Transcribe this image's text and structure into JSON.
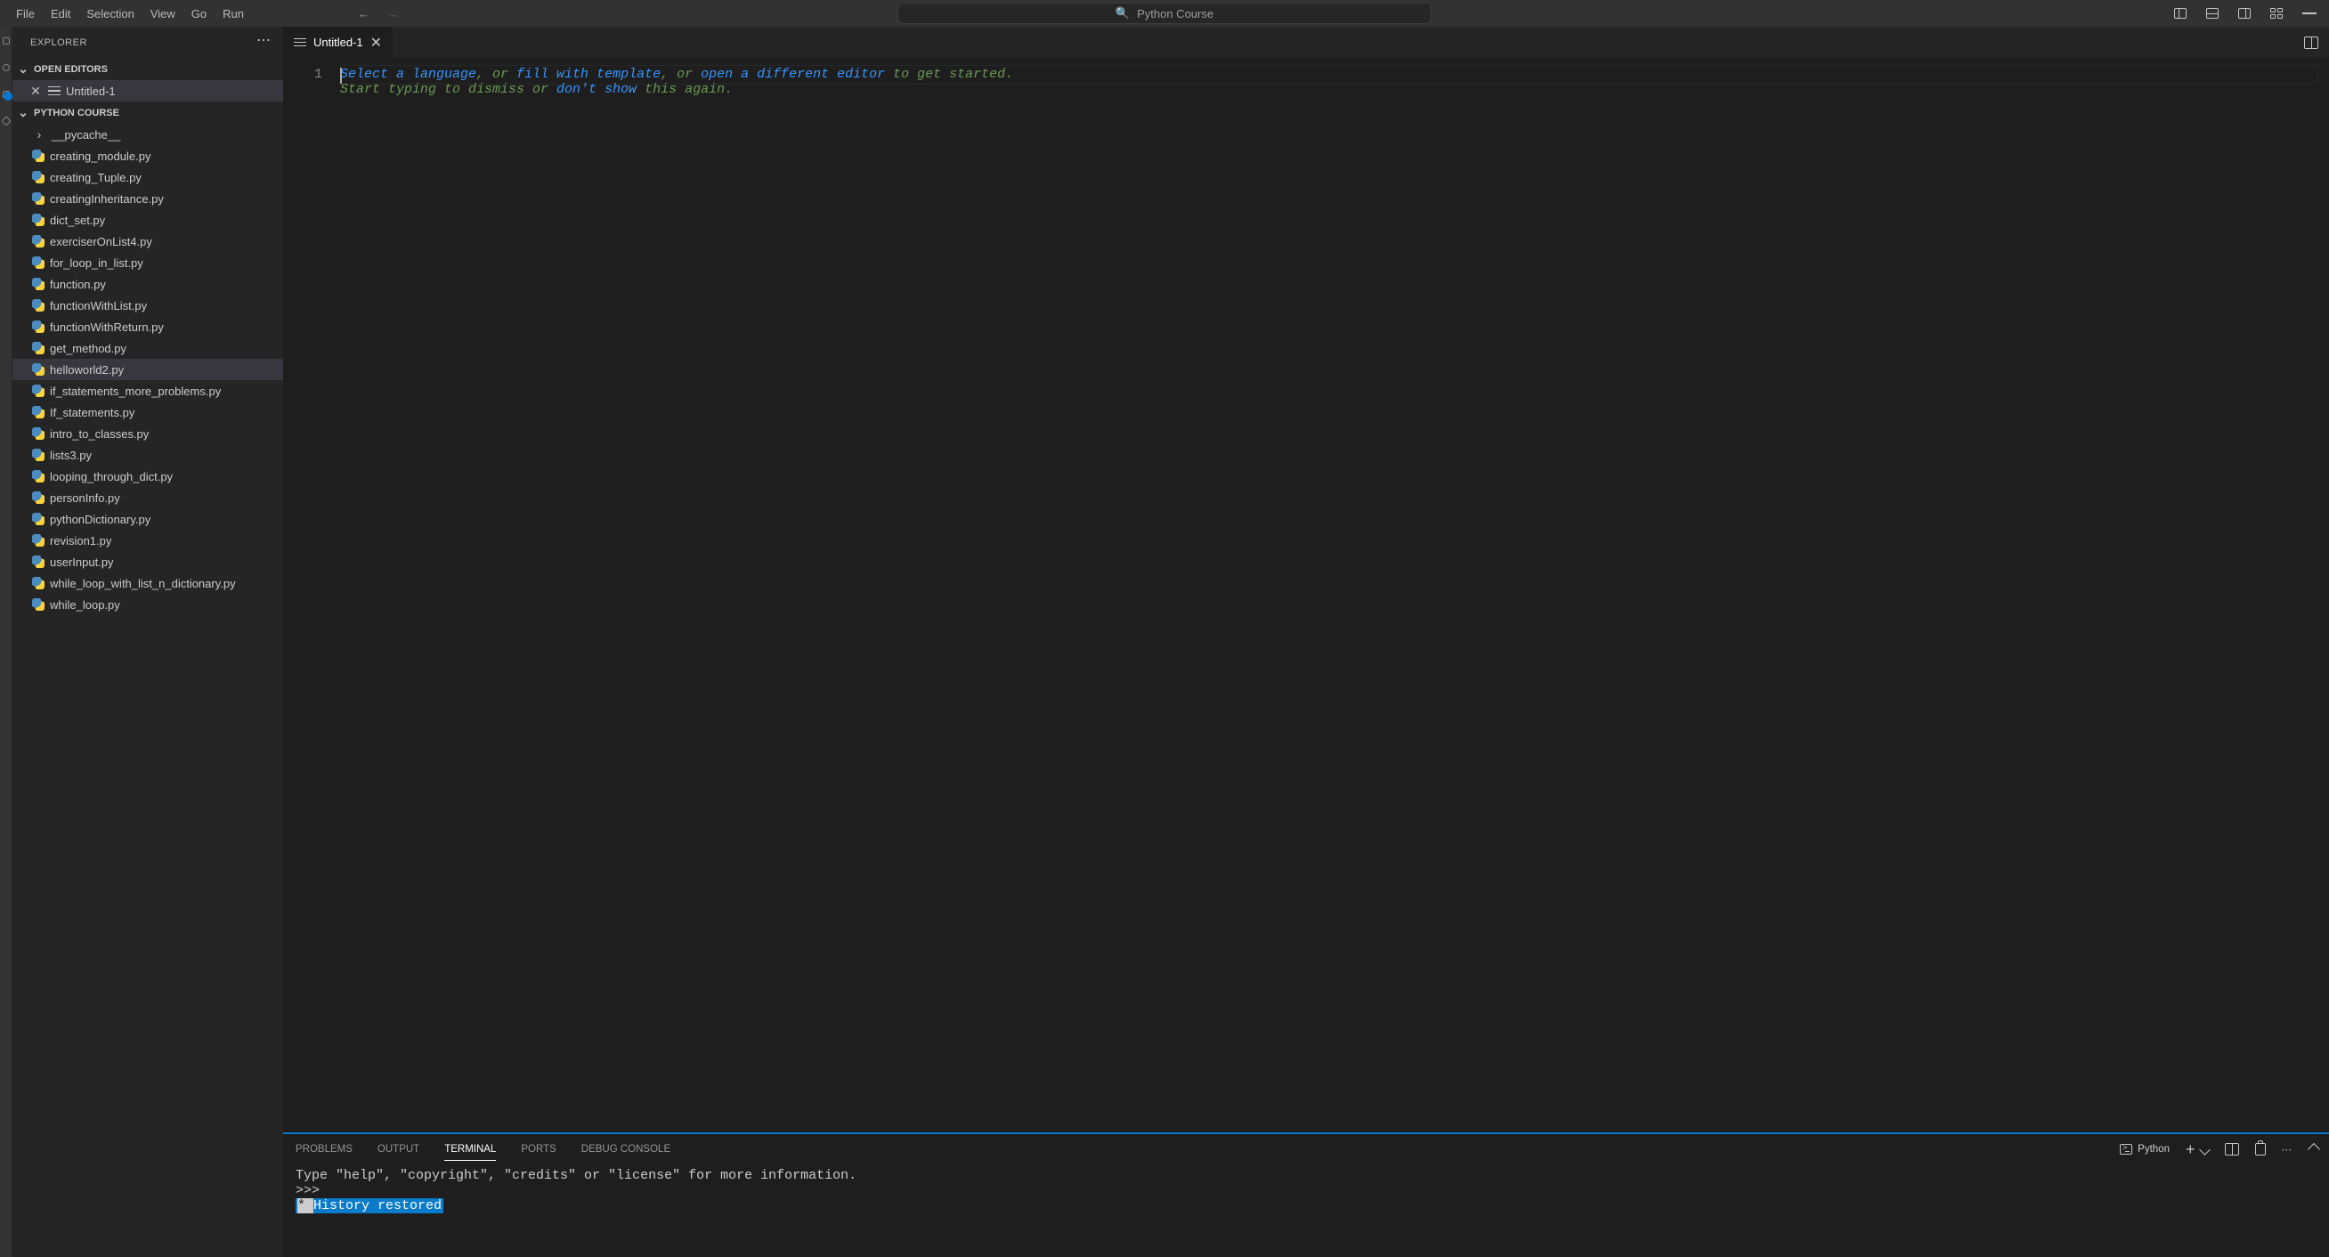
{
  "menubar": {
    "items": [
      "File",
      "Edit",
      "Selection",
      "View",
      "Go",
      "Run"
    ],
    "search_placeholder": "Python Course"
  },
  "explorer": {
    "title": "EXPLORER",
    "sections": {
      "open_editors_label": "OPEN EDITORS",
      "project_label": "PYTHON COURSE"
    },
    "open_editors": [
      {
        "name": "Untitled-1"
      }
    ],
    "tree": [
      {
        "name": "__pycache__",
        "kind": "folder"
      },
      {
        "name": "creating_module.py",
        "kind": "py"
      },
      {
        "name": "creating_Tuple.py",
        "kind": "py"
      },
      {
        "name": "creatingInheritance.py",
        "kind": "py"
      },
      {
        "name": "dict_set.py",
        "kind": "py"
      },
      {
        "name": "exerciserOnList4.py",
        "kind": "py"
      },
      {
        "name": "for_loop_in_list.py",
        "kind": "py"
      },
      {
        "name": "function.py",
        "kind": "py"
      },
      {
        "name": "functionWithList.py",
        "kind": "py"
      },
      {
        "name": "functionWithReturn.py",
        "kind": "py"
      },
      {
        "name": "get_method.py",
        "kind": "py"
      },
      {
        "name": "helloworld2.py",
        "kind": "py",
        "selected": true
      },
      {
        "name": "if_statements_more_problems.py",
        "kind": "py"
      },
      {
        "name": "If_statements.py",
        "kind": "py"
      },
      {
        "name": "intro_to_classes.py",
        "kind": "py"
      },
      {
        "name": "lists3.py",
        "kind": "py"
      },
      {
        "name": "looping_through_dict.py",
        "kind": "py"
      },
      {
        "name": "personInfo.py",
        "kind": "py"
      },
      {
        "name": "pythonDictionary.py",
        "kind": "py"
      },
      {
        "name": "revision1.py",
        "kind": "py"
      },
      {
        "name": "userInput.py",
        "kind": "py"
      },
      {
        "name": "while_loop_with_list_n_dictionary.py",
        "kind": "py"
      },
      {
        "name": "while_loop.py",
        "kind": "py"
      }
    ]
  },
  "editor": {
    "tab_label": "Untitled-1",
    "gutter": "1",
    "placeholder": {
      "p1a": "Select a language",
      "p1b": ", or ",
      "p1c": "fill with template",
      "p1d": ", or ",
      "p1e": "open a different editor",
      "p1f": " to get started.",
      "p2a": "Start typing to dismiss or ",
      "p2b": "don't show",
      "p2c": " this again."
    }
  },
  "panel": {
    "tabs": [
      "PROBLEMS",
      "OUTPUT",
      "TERMINAL",
      "PORTS",
      "DEBUG CONSOLE"
    ],
    "active_tab": "TERMINAL",
    "kernel_label": "Python",
    "lines": {
      "l1": "Type \"help\", \"copyright\", \"credits\" or \"license\" for more information.",
      "l2": ">>>",
      "l3_star": " * ",
      "l3_text": " History restored "
    }
  }
}
